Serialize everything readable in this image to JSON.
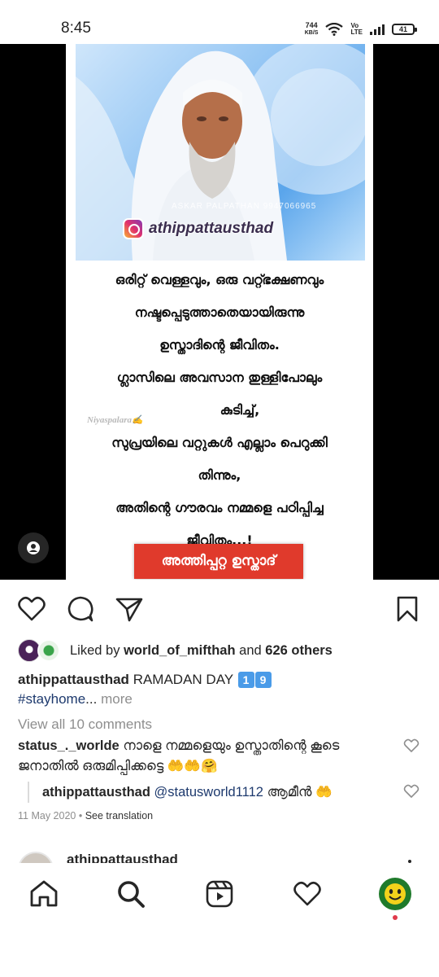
{
  "status_bar": {
    "time": "8:45",
    "net_speed_value": "744",
    "net_speed_unit": "KB/S",
    "volte_top": "Vo",
    "volte_bottom": "LTE",
    "battery": "41"
  },
  "post": {
    "image": {
      "photo_watermark": "ASKAR PALPATHAN 9947066965",
      "instagram_handle": "athippattausthad",
      "quote_lines": [
        "ഒരിറ്റ് വെള്ളവും, ഒരു വറ്റ്ഭക്ഷണവും",
        "നഷ്ടപ്പെടുത്താതെയായിരുന്നു",
        "ഉസ്താദിന്റെ ജീവിതം.",
        "ഗ്ലാസിലെ അവസാന തുള്ളിപോലും",
        "കുടിച്ച്,",
        "സുപ്രയിലെ വറ്റുകൾ എല്ലാം പെറുക്കി",
        "തിന്നും,",
        "അതിന്റെ ഗൗരവം നമ്മളെ പഠിപ്പിച്ച",
        "ജീവിതം...!"
      ],
      "signature": "Niyaspalara✍",
      "banner": "അത്തിപ്പറ്റ ഉസ്താദ്"
    },
    "likes": {
      "prefix": "Liked by",
      "user": "world_of_mifthah",
      "joiner": "and",
      "others": "626 others"
    },
    "caption": {
      "username": "athippattausthad",
      "text": "RAMADAN DAY",
      "day_digit_1": "1",
      "day_digit_2": "9",
      "hashtag": "#stayhome",
      "ellipsis": "...",
      "more": "more"
    },
    "view_all_comments": "View all 10 comments",
    "comments": [
      {
        "username": "status_._worlde",
        "text": "നാളെ നമ്മളെയും ഉസ്താതിന്റെ കൂടെ ജനാതിൽ ഒരുമിപ്പിക്കട്ടെ 🤲🤲🤗"
      }
    ],
    "reply": {
      "username": "athippattausthad",
      "mention": "@statusworld1112",
      "text": "ആമീൻ 🤲"
    },
    "date": "11 May 2020",
    "separator": "•",
    "see_translation": "See translation"
  },
  "next_post": {
    "username": "athippattausthad"
  },
  "bottom_nav": {
    "items": [
      "home-icon",
      "search-icon",
      "reels-icon",
      "activity-heart-icon",
      "profile-avatar"
    ]
  }
}
